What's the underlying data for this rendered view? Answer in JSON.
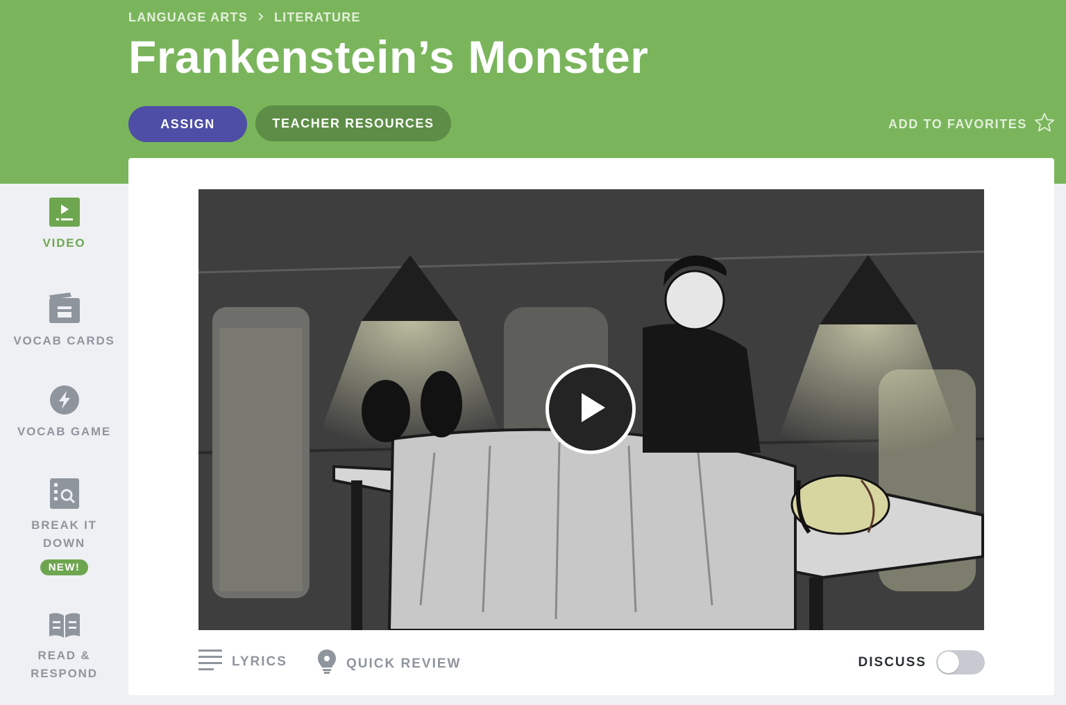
{
  "breadcrumb": {
    "category": "LANGUAGE ARTS",
    "subcategory": "LITERATURE"
  },
  "page": {
    "title": "Frankenstein’s Monster"
  },
  "actions": {
    "assign_label": "ASSIGN",
    "resources_label": "TEACHER RESOURCES",
    "favorites_label": "ADD TO FAVORITES"
  },
  "sidebar": {
    "items": [
      {
        "label": "VIDEO",
        "icon": "video-icon",
        "active": true
      },
      {
        "label": "VOCAB CARDS",
        "icon": "vocab-cards-icon",
        "active": false
      },
      {
        "label": "VOCAB GAME",
        "icon": "lightning-icon",
        "active": false
      },
      {
        "label_line1": "BREAK IT",
        "label_line2": "DOWN",
        "badge": "NEW!",
        "icon": "magnify-icon",
        "active": false
      },
      {
        "label_line1": "READ &",
        "label_line2": "RESPOND",
        "icon": "book-icon",
        "active": false
      }
    ]
  },
  "player": {
    "lyrics_label": "LYRICS",
    "review_label": "QUICK REVIEW",
    "discuss_label": "DISCUSS",
    "discuss_enabled": false
  },
  "colors": {
    "header_green": "#7ab55c",
    "assign_purple": "#4e4ea6",
    "resources_green": "#5d8d46",
    "active_green": "#6ea650",
    "muted_gray": "#8f959d"
  }
}
